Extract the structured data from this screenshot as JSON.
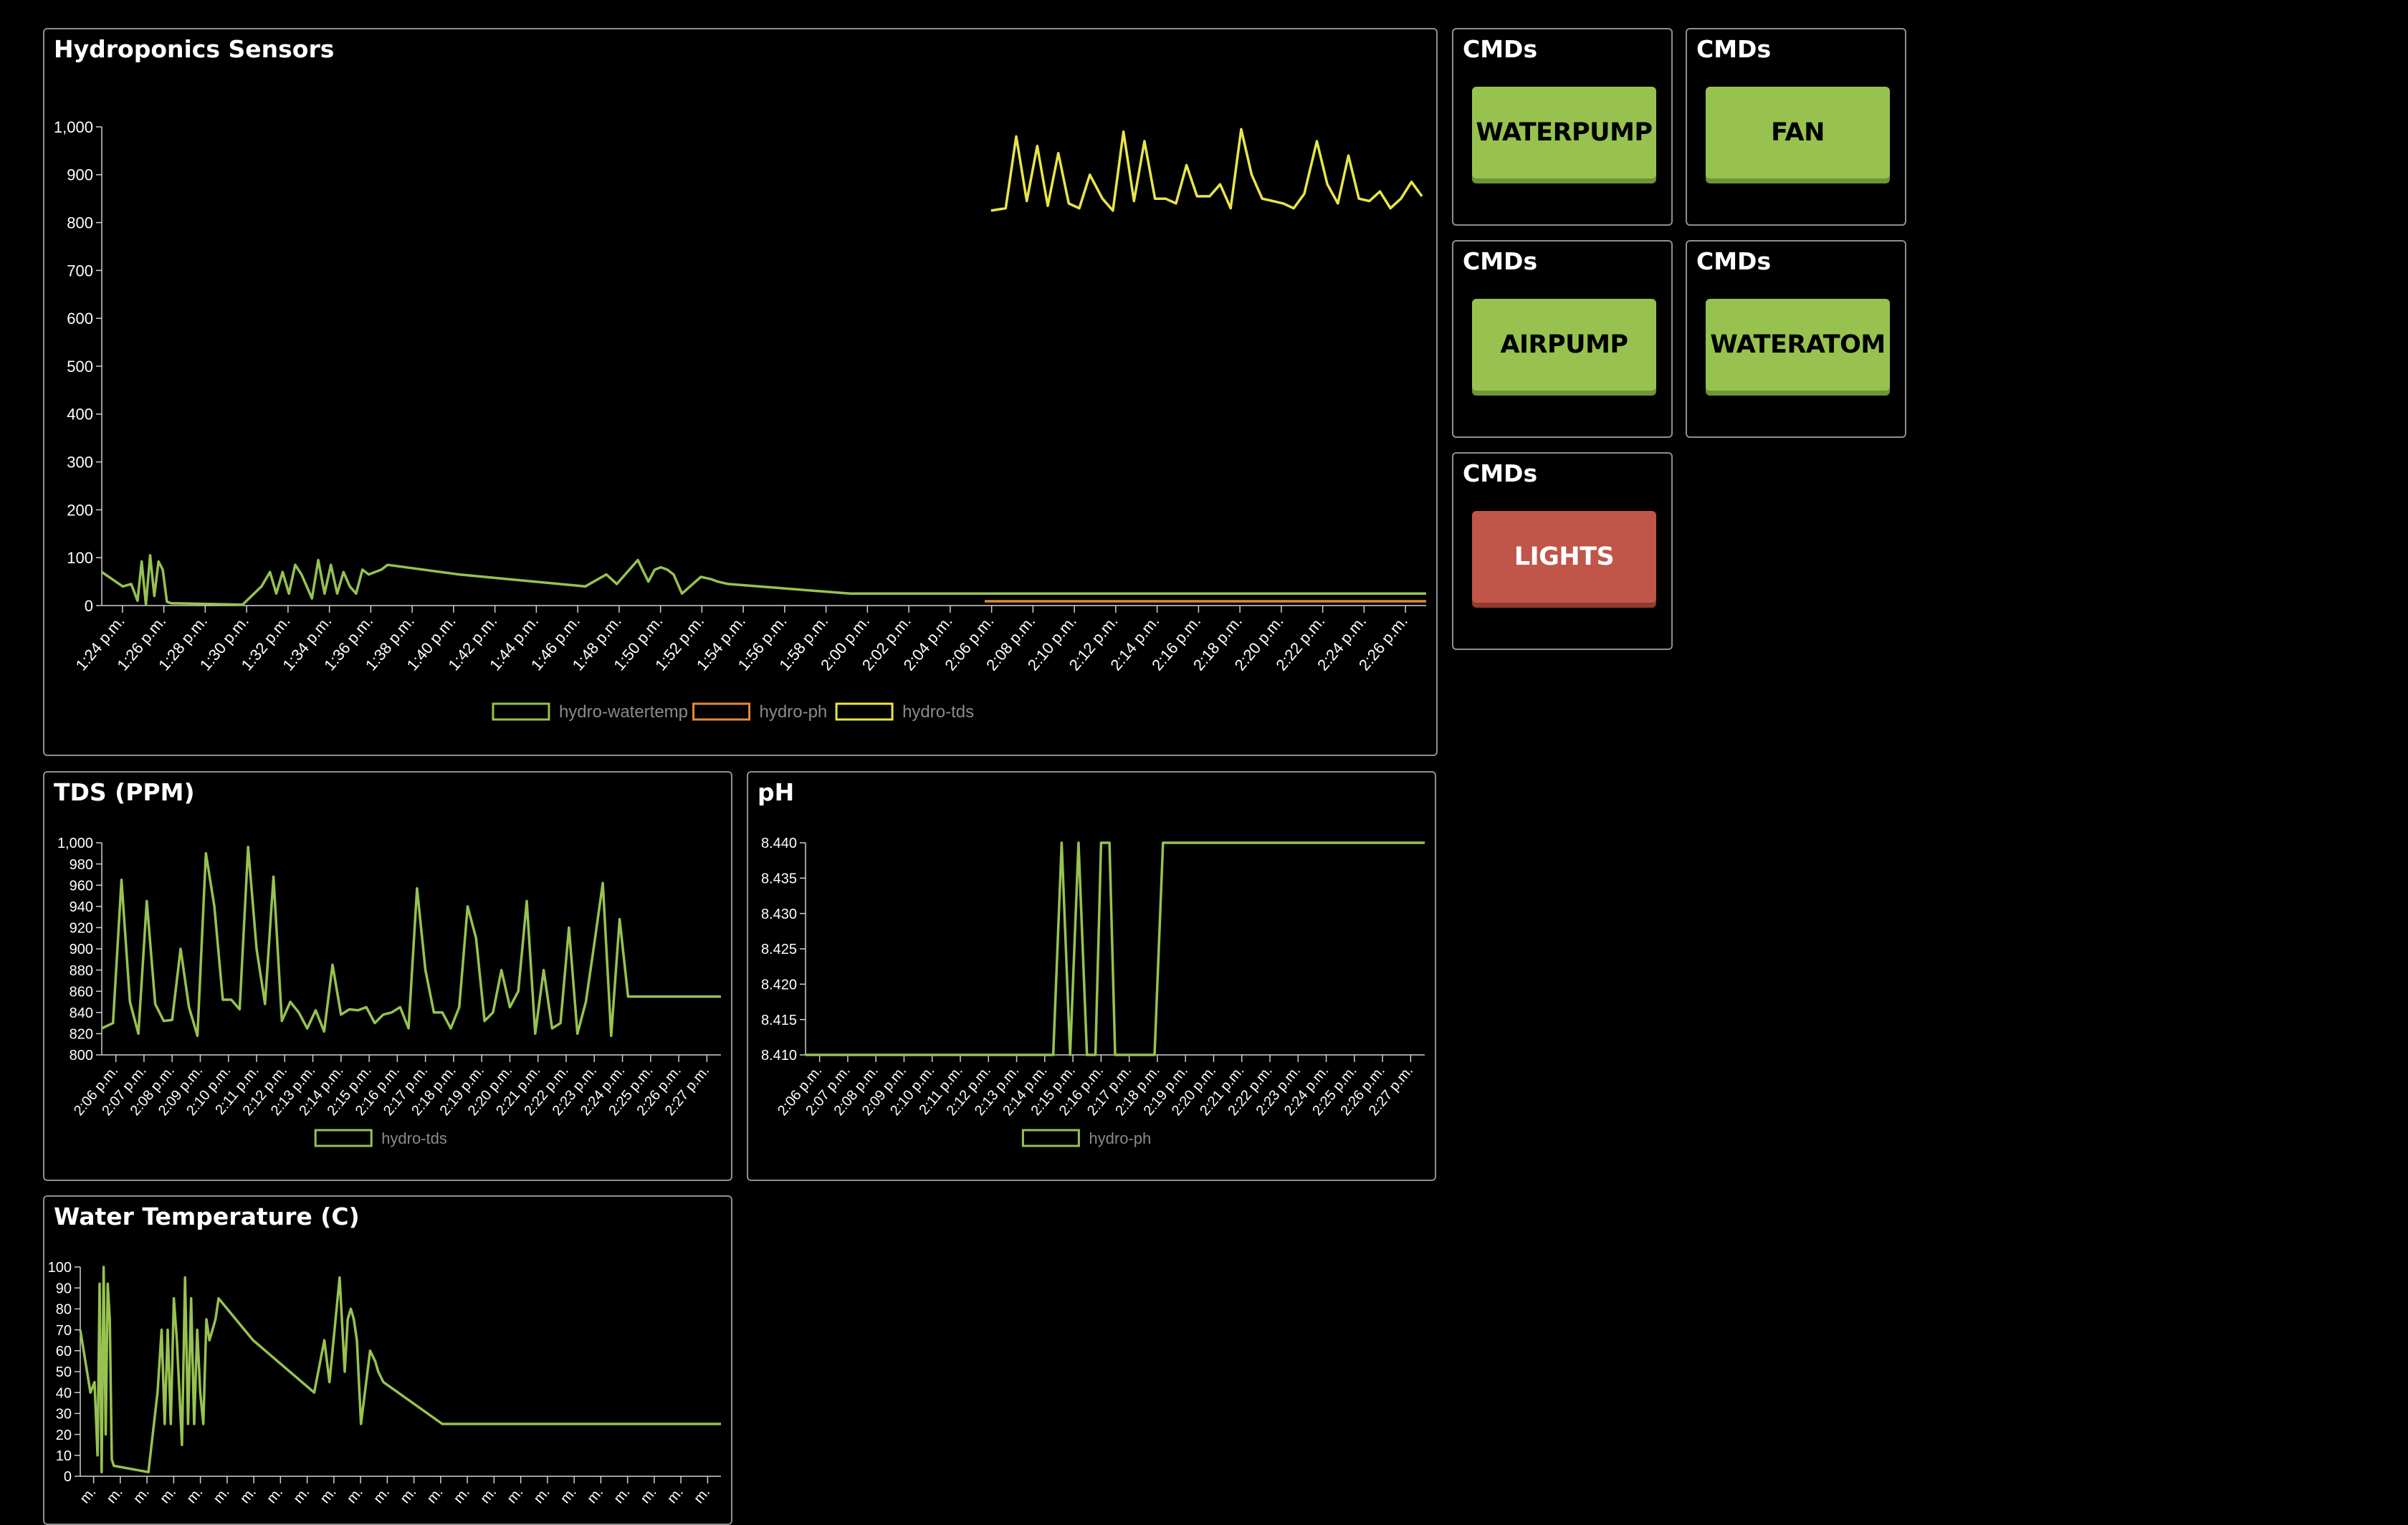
{
  "colors": {
    "background": "#000000",
    "panel_border": "#8f8f8f",
    "axis": "#cfcfcf",
    "legend_text": "#8a8a8a",
    "btn_on": "#97c250",
    "btn_on_shadow": "#6e9436",
    "btn_off": "#c0554a",
    "btn_off_shadow": "#93392f",
    "btn_on_text": "#000000",
    "btn_off_text": "#ffffff"
  },
  "panels": {
    "sensors": {
      "title": "Hydroponics Sensors"
    },
    "tds": {
      "title": "TDS (PPM)"
    },
    "ph": {
      "title": "pH"
    },
    "temp": {
      "title": "Water Temperature (C)"
    }
  },
  "commands": [
    {
      "title": "CMDs",
      "label": "WATERPUMP",
      "state": "on"
    },
    {
      "title": "CMDs",
      "label": "FAN",
      "state": "on"
    },
    {
      "title": "CMDs",
      "label": "AIRPUMP",
      "state": "on"
    },
    {
      "title": "CMDs",
      "label": "WATERATOM",
      "state": "on"
    },
    {
      "title": "CMDs",
      "label": "LIGHTS",
      "state": "off"
    }
  ],
  "chart_data": [
    {
      "id": "sensors",
      "type": "line",
      "title": "Hydroponics Sensors",
      "ylim": [
        0,
        1000
      ],
      "yticks": [
        0,
        100,
        200,
        300,
        400,
        500,
        600,
        700,
        800,
        900,
        1000
      ],
      "ytick_labels": [
        "0",
        "100",
        "200",
        "300",
        "400",
        "500",
        "600",
        "700",
        "800",
        "900",
        "1,000"
      ],
      "xlim": [
        0,
        63
      ],
      "xtick_labels": [
        "1:24 p.m.",
        "1:26 p.m.",
        "1:28 p.m.",
        "1:30 p.m.",
        "1:32 p.m.",
        "1:34 p.m.",
        "1:36 p.m.",
        "1:38 p.m.",
        "1:40 p.m.",
        "1:42 p.m.",
        "1:44 p.m.",
        "1:46 p.m.",
        "1:48 p.m.",
        "1:50 p.m.",
        "1:52 p.m.",
        "1:54 p.m.",
        "1:56 p.m.",
        "1:58 p.m.",
        "2:00 p.m.",
        "2:02 p.m.",
        "2:04 p.m.",
        "2:06 p.m.",
        "2:08 p.m.",
        "2:10 p.m.",
        "2:12 p.m.",
        "2:14 p.m.",
        "2:16 p.m.",
        "2:18 p.m.",
        "2:20 p.m.",
        "2:22 p.m.",
        "2:24 p.m.",
        "2:26 p.m."
      ],
      "legend": "bottom-center",
      "series": [
        {
          "name": "hydro-watertemp",
          "color": "#97c250",
          "x": [
            0,
            1,
            1.4,
            1.7,
            1.9,
            2.1,
            2.3,
            2.5,
            2.7,
            2.9,
            3.1,
            3.3,
            6.7,
            7.6,
            8,
            8.3,
            8.6,
            8.9,
            9.2,
            9.5,
            10,
            10.3,
            10.6,
            10.9,
            11.2,
            11.5,
            11.8,
            12.1,
            12.4,
            12.7,
            13,
            13.3,
            13.6,
            17,
            23,
            24,
            24.5,
            25.5,
            26,
            26.3,
            26.6,
            26.9,
            27.2,
            27.6,
            28.5,
            29,
            29.3,
            29.8,
            35.6,
            63
          ],
          "y": [
            70,
            40,
            45,
            10,
            92,
            2,
            105,
            20,
            92,
            75,
            8,
            5,
            2,
            40,
            70,
            25,
            70,
            25,
            85,
            65,
            15,
            95,
            25,
            85,
            25,
            70,
            40,
            25,
            75,
            65,
            70,
            75,
            85,
            65,
            40,
            65,
            45,
            95,
            50,
            75,
            80,
            75,
            65,
            25,
            60,
            55,
            50,
            45,
            25,
            25
          ]
        },
        {
          "name": "hydro-ph",
          "color": "#e28a3d",
          "x": [
            42,
            63
          ],
          "y": [
            8.41,
            8.44
          ]
        },
        {
          "name": "hydro-tds",
          "color": "#e8e54a",
          "x": [
            42.3,
            43,
            43.5,
            44,
            44.5,
            45,
            45.5,
            46,
            46.5,
            47,
            47.6,
            48.1,
            48.6,
            49.1,
            49.6,
            50.1,
            50.6,
            51.1,
            51.6,
            52.1,
            52.7,
            53.2,
            53.7,
            54.2,
            54.7,
            55.2,
            55.7,
            56.2,
            56.7,
            57.2,
            57.8,
            58.3,
            58.8,
            59.3,
            59.8,
            60.3,
            60.8,
            61.3,
            61.8,
            62.3,
            62.8
          ],
          "y": [
            825,
            830,
            980,
            845,
            960,
            835,
            945,
            840,
            830,
            900,
            850,
            825,
            990,
            845,
            970,
            850,
            850,
            840,
            920,
            855,
            855,
            880,
            830,
            995,
            900,
            850,
            845,
            840,
            830,
            860,
            970,
            880,
            840,
            940,
            850,
            845,
            865,
            830,
            850,
            885,
            855
          ]
        }
      ]
    },
    {
      "id": "tds",
      "type": "line",
      "title": "TDS (PPM)",
      "ylim": [
        800,
        1000
      ],
      "yticks": [
        800,
        820,
        840,
        860,
        880,
        900,
        920,
        940,
        960,
        980,
        1000
      ],
      "ytick_labels": [
        "800",
        "820",
        "840",
        "860",
        "880",
        "900",
        "920",
        "940",
        "960",
        "980",
        "1,000"
      ],
      "xlim": [
        0,
        22
      ],
      "xtick_labels": [
        "2:06 p.m.",
        "2:07 p.m.",
        "2:08 p.m.",
        "2:09 p.m.",
        "2:10 p.m.",
        "2:11 p.m.",
        "2:12 p.m.",
        "2:13 p.m.",
        "2:14 p.m.",
        "2:15 p.m.",
        "2:16 p.m.",
        "2:17 p.m.",
        "2:18 p.m.",
        "2:19 p.m.",
        "2:20 p.m.",
        "2:21 p.m.",
        "2:22 p.m.",
        "2:23 p.m.",
        "2:24 p.m.",
        "2:25 p.m.",
        "2:26 p.m.",
        "2:27 p.m."
      ],
      "legend": "bottom-center",
      "series": [
        {
          "name": "hydro-tds",
          "color": "#97c250",
          "x": [
            0,
            0.4,
            0.7,
            1.0,
            1.3,
            1.6,
            1.9,
            2.2,
            2.5,
            2.8,
            3.1,
            3.4,
            3.7,
            4.0,
            4.3,
            4.6,
            4.9,
            5.2,
            5.5,
            5.8,
            6.1,
            6.4,
            6.7,
            7.0,
            7.3,
            7.6,
            7.9,
            8.2,
            8.5,
            8.8,
            9.1,
            9.4,
            9.7,
            10.0,
            10.3,
            10.6,
            10.9,
            11.2,
            11.5,
            11.8,
            12.1,
            12.4,
            12.7,
            13.0,
            13.3,
            13.6,
            13.9,
            14.2,
            14.5,
            14.8,
            15.1,
            15.4,
            15.7,
            16.0,
            16.3,
            16.6,
            16.9,
            17.2,
            17.5,
            17.8,
            18.1,
            18.4,
            18.7,
            19.0,
            19.3,
            19.6,
            19.9,
            20.2,
            20.5,
            20.8,
            21.1,
            21.4,
            21.7,
            22.0
          ],
          "y": [
            825,
            830,
            965,
            850,
            820,
            945,
            848,
            832,
            833,
            900,
            845,
            818,
            990,
            940,
            852,
            852,
            843,
            996,
            900,
            848,
            968,
            832,
            850,
            840,
            825,
            842,
            822,
            885,
            838,
            843,
            842,
            845,
            830,
            838,
            840,
            845,
            825,
            957,
            880,
            840,
            840,
            825,
            845,
            940,
            910,
            832,
            840,
            880,
            845,
            860,
            945,
            820,
            880,
            825,
            830,
            920,
            820,
            850,
            905,
            962,
            818,
            928,
            855,
            855,
            855,
            855,
            855,
            855,
            855,
            855,
            855,
            855,
            855,
            855
          ]
        }
      ]
    },
    {
      "id": "ph",
      "type": "line",
      "title": "pH",
      "ylim": [
        8.41,
        8.44
      ],
      "yticks": [
        8.41,
        8.415,
        8.42,
        8.425,
        8.43,
        8.435,
        8.44
      ],
      "ytick_labels": [
        "8.410",
        "8.415",
        "8.420",
        "8.425",
        "8.430",
        "8.435",
        "8.440"
      ],
      "xlim": [
        0,
        22
      ],
      "xtick_labels": [
        "2:06 p.m.",
        "2:07 p.m.",
        "2:08 p.m.",
        "2:09 p.m.",
        "2:10 p.m.",
        "2:11 p.m.",
        "2:12 p.m.",
        "2:13 p.m.",
        "2:14 p.m.",
        "2:15 p.m.",
        "2:16 p.m.",
        "2:17 p.m.",
        "2:18 p.m.",
        "2:19 p.m.",
        "2:20 p.m.",
        "2:21 p.m.",
        "2:22 p.m.",
        "2:23 p.m.",
        "2:24 p.m.",
        "2:25 p.m.",
        "2:26 p.m.",
        "2:27 p.m."
      ],
      "legend": "bottom-center",
      "series": [
        {
          "name": "hydro-ph",
          "color": "#97c250",
          "x": [
            0,
            8.8,
            9.1,
            9.4,
            9.7,
            10.0,
            10.3,
            10.5,
            10.8,
            11.0,
            11.2,
            11.6,
            12.4,
            12.7,
            22
          ],
          "y": [
            8.41,
            8.41,
            8.44,
            8.41,
            8.44,
            8.41,
            8.41,
            8.44,
            8.44,
            8.41,
            8.41,
            8.41,
            8.41,
            8.44,
            8.44
          ]
        }
      ]
    },
    {
      "id": "temp",
      "type": "line",
      "title": "Water Temperature (C)",
      "ylim": [
        0,
        100
      ],
      "yticks": [
        0,
        10,
        20,
        30,
        40,
        50,
        60,
        70,
        80,
        90,
        100
      ],
      "ytick_labels": [
        "0",
        "10",
        "20",
        "30",
        "40",
        "50",
        "60",
        "70",
        "80",
        "90",
        "100"
      ],
      "xlim": [
        0,
        63
      ],
      "xtick_labels": [
        "m.",
        "m.",
        "m.",
        "m.",
        "m.",
        "m.",
        "m.",
        "m.",
        "m.",
        "m.",
        "m.",
        "m.",
        "m.",
        "m.",
        "m.",
        "m.",
        "m.",
        "m.",
        "m.",
        "m.",
        "m.",
        "m.",
        "m.",
        "m."
      ],
      "legend": "bottom-center",
      "series": [
        {
          "name": "hydro-watertemp",
          "color": "#97c250",
          "x": [
            0,
            1,
            1.4,
            1.7,
            1.9,
            2.1,
            2.3,
            2.5,
            2.7,
            2.9,
            3.1,
            3.3,
            6.7,
            7.6,
            8,
            8.3,
            8.6,
            8.9,
            9.2,
            9.5,
            10,
            10.3,
            10.6,
            10.9,
            11.2,
            11.5,
            11.8,
            12.1,
            12.4,
            12.7,
            13,
            13.3,
            13.6,
            17,
            23,
            24,
            24.5,
            25.5,
            26,
            26.3,
            26.6,
            26.9,
            27.2,
            27.6,
            28.5,
            29,
            29.3,
            29.8,
            35.6,
            63
          ],
          "y": [
            70,
            40,
            45,
            10,
            92,
            2,
            105,
            20,
            92,
            75,
            8,
            5,
            2,
            40,
            70,
            25,
            70,
            25,
            85,
            65,
            15,
            95,
            25,
            85,
            25,
            70,
            40,
            25,
            75,
            65,
            70,
            75,
            85,
            65,
            40,
            65,
            45,
            95,
            50,
            75,
            80,
            75,
            65,
            25,
            60,
            55,
            50,
            45,
            25,
            25
          ]
        }
      ]
    }
  ]
}
